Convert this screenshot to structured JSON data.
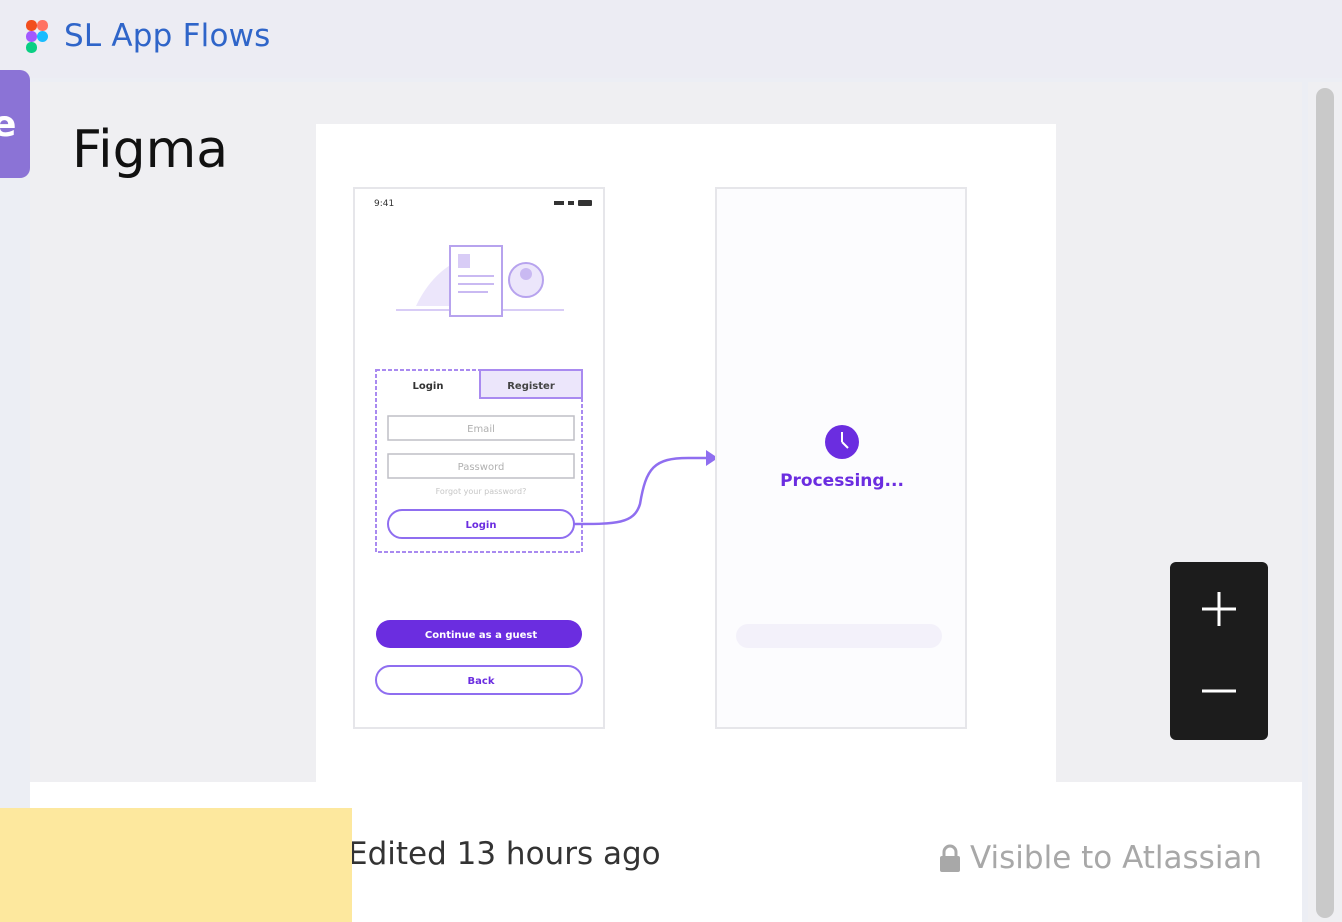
{
  "header": {
    "title": "SL App Flows",
    "logo_icon": "figma-logo-icon"
  },
  "side_tab": {
    "label": "e"
  },
  "card": {
    "app_name": "Figma"
  },
  "preview": {
    "status_time": "9:41",
    "tab_login": "Login",
    "tab_register": "Register",
    "email_placeholder": "Email",
    "password_placeholder": "Password",
    "forgot_link": "Forgot your password?",
    "login_button": "Login",
    "guest_button": "Continue as a guest",
    "back_button": "Back",
    "processing_text": "Processing..."
  },
  "zoom": {
    "in_icon": "plus-icon",
    "out_icon": "minus-icon"
  },
  "footer": {
    "edited": "Edited 13 hours ago",
    "visibility": "Visible to Atlassian",
    "visibility_icon": "lock-icon"
  },
  "colors": {
    "accent": "#6b2de0",
    "link": "#2f65c9",
    "outline": "#a98af0"
  }
}
